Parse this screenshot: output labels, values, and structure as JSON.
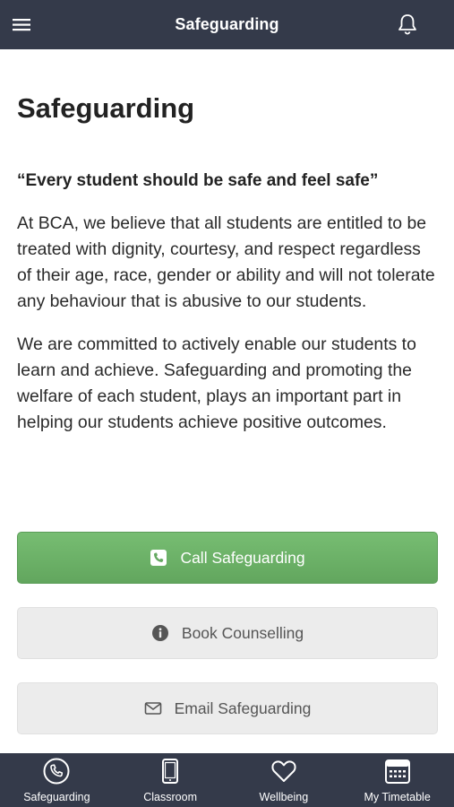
{
  "header": {
    "title": "Safeguarding",
    "menu_icon": "hamburger-menu-icon",
    "notification_icon": "bell-icon"
  },
  "main": {
    "page_title": "Safeguarding",
    "quote": "“Every student should be safe and feel safe”",
    "paragraphs": [
      "At BCA, we believe that all students are entitled to be treated with dignity, courtesy, and respect regardless of their age, race, gender or ability and will not tolerate any behaviour that is abusive to our students.",
      "We are committed to actively enable our students to learn and achieve. Safeguarding and promoting the welfare of each student, plays an important part in helping our students achieve positive outcomes."
    ]
  },
  "actions": {
    "call_label": "Call Safeguarding",
    "book_label": "Book Counselling",
    "email_label": "Email Safeguarding"
  },
  "tabbar": {
    "items": [
      {
        "label": "Safeguarding",
        "icon": "phone-circle-icon"
      },
      {
        "label": "Classroom",
        "icon": "tablet-icon"
      },
      {
        "label": "Wellbeing",
        "icon": "heart-icon"
      },
      {
        "label": "My Timetable",
        "icon": "calendar-icon"
      }
    ]
  },
  "colors": {
    "header_bg": "#343a4a",
    "primary_button": "#6aaf66",
    "secondary_button": "#ececec"
  }
}
